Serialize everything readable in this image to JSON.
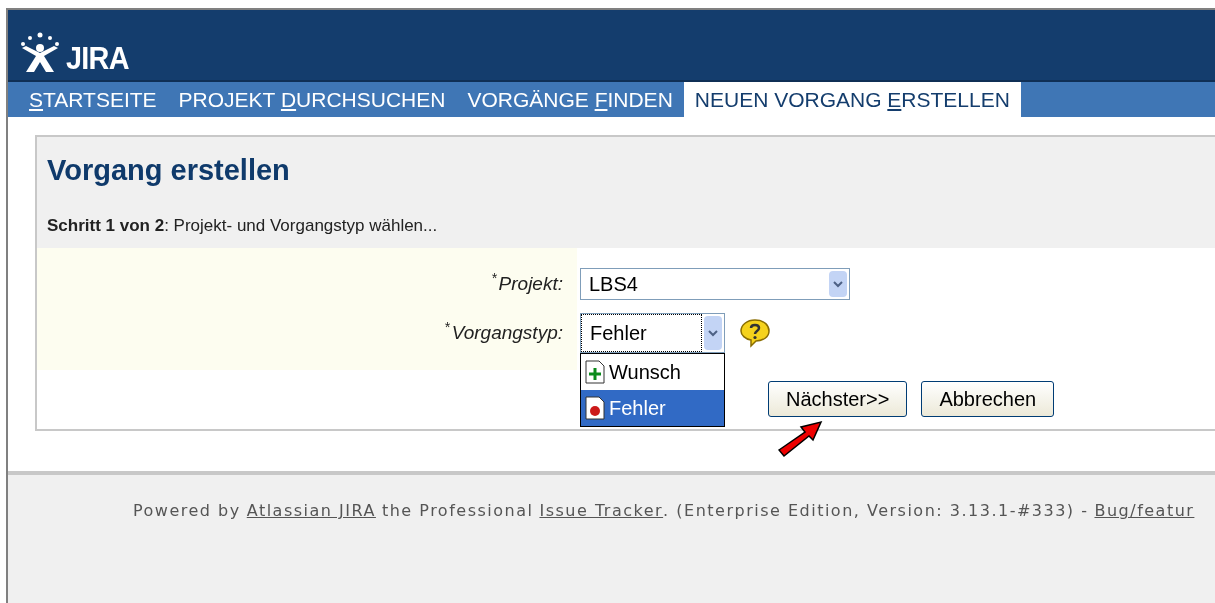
{
  "header": {
    "logo_text": "JIRA"
  },
  "nav": {
    "tabs": [
      {
        "key": "S",
        "after": "TARTSEITE",
        "selected": false
      },
      {
        "before": "PROJEKT ",
        "key": "D",
        "after": "URCHSUCHEN",
        "selected": false
      },
      {
        "before": "VORGÄNGE ",
        "key": "F",
        "after": "INDEN",
        "selected": false
      },
      {
        "before": "NEUEN VORGANG ",
        "key": "E",
        "after": "RSTELLEN",
        "selected": true
      }
    ]
  },
  "page": {
    "title": "Vorgang erstellen",
    "step": "**Schritt 1 von 2**: Projekt- und Vorgangstyp wählen...",
    "fields": [
      {
        "label": "Projekt:",
        "required_mark": "*",
        "value": "LBS4"
      },
      {
        "label": "Vorgangstyp:",
        "required_mark": "*",
        "value": "Fehler",
        "help": true,
        "expanded": true,
        "options": [
          {
            "label": "Wunsch",
            "kind": "wish",
            "selected": false
          },
          {
            "label": "Fehler",
            "kind": "bug",
            "selected": true
          }
        ]
      }
    ],
    "buttons": [
      "Nächster>>",
      "Abbrechen"
    ],
    "pointer_arrow": true
  },
  "footer": {
    "segments": [
      {
        "kind": "text",
        "text": "Powered by"
      },
      {
        "kind": "link",
        "text": "Atlassian JIRA"
      },
      {
        "kind": "text",
        "text": "the Professional"
      },
      {
        "kind": "link",
        "text": "Issue Tracker"
      },
      {
        "kind": "text",
        "text": ". (Enterprise Edition, Version: 3.13.1-#333) -",
        "joined": true
      },
      {
        "kind": "link",
        "text": "Bug/featur"
      }
    ]
  }
}
